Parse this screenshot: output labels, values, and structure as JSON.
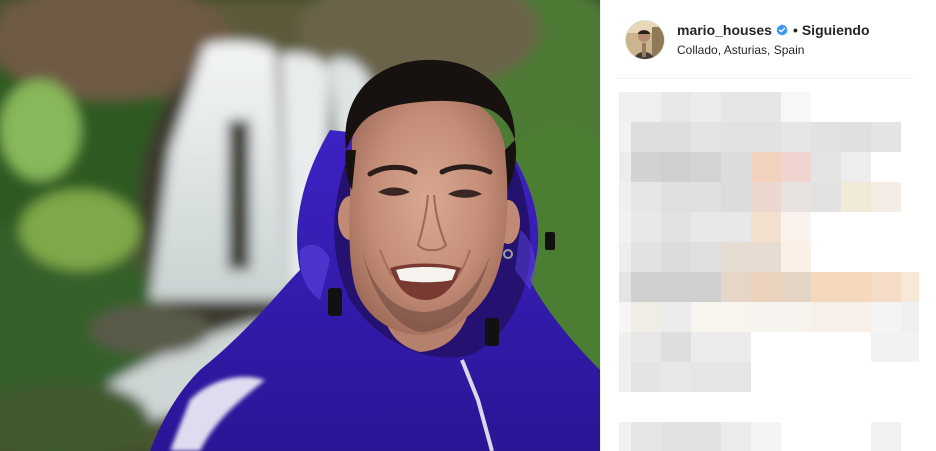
{
  "post": {
    "author": {
      "username": "mario_houses",
      "verified_icon": "verified-badge-icon",
      "separator": "•",
      "follow_status": "Siguiendo",
      "location": "Collado, Asturias, Spain"
    },
    "photo": {
      "icon": "selfie-waterfall-photo"
    },
    "comments": {
      "state": "pixelated"
    }
  },
  "colors": {
    "verified": "#3897f0",
    "text": "#262626",
    "jacket": "#3a20b8",
    "divider": "#efefef"
  }
}
